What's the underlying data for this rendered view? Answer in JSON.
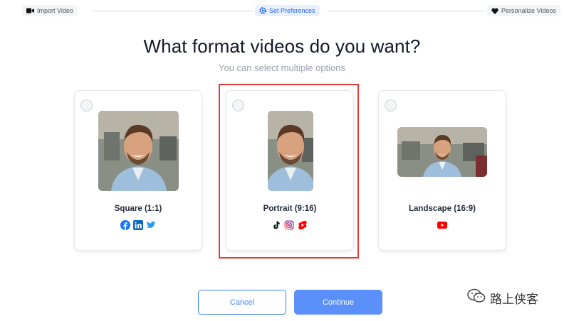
{
  "stepper": {
    "steps": [
      {
        "label": "Import Video",
        "icon": "video-camera-icon",
        "state": "done"
      },
      {
        "label": "Set Preferences",
        "icon": "gear-icon",
        "state": "active"
      },
      {
        "label": "Personalize Videos",
        "icon": "heart-icon",
        "state": "upcoming"
      }
    ]
  },
  "heading": {
    "title": "What format videos do you want?",
    "subtitle": "You can select multiple options"
  },
  "formats": [
    {
      "label": "Square (1:1)",
      "platforms": [
        "facebook-icon",
        "linkedin-icon",
        "twitter-icon"
      ],
      "selected": false
    },
    {
      "label": "Portrait (9:16)",
      "platforms": [
        "tiktok-icon",
        "instagram-icon",
        "youtube-shorts-icon"
      ],
      "selected": false,
      "highlighted": true
    },
    {
      "label": "Landscape (16:9)",
      "platforms": [
        "youtube-icon"
      ],
      "selected": false
    }
  ],
  "actions": {
    "cancel_label": "Cancel",
    "continue_label": "Continue"
  },
  "watermark": {
    "text": "路上侠客"
  },
  "colors": {
    "accent": "#5b8ff9",
    "highlight_border": "#e53935",
    "active_step_text": "#2563eb"
  }
}
